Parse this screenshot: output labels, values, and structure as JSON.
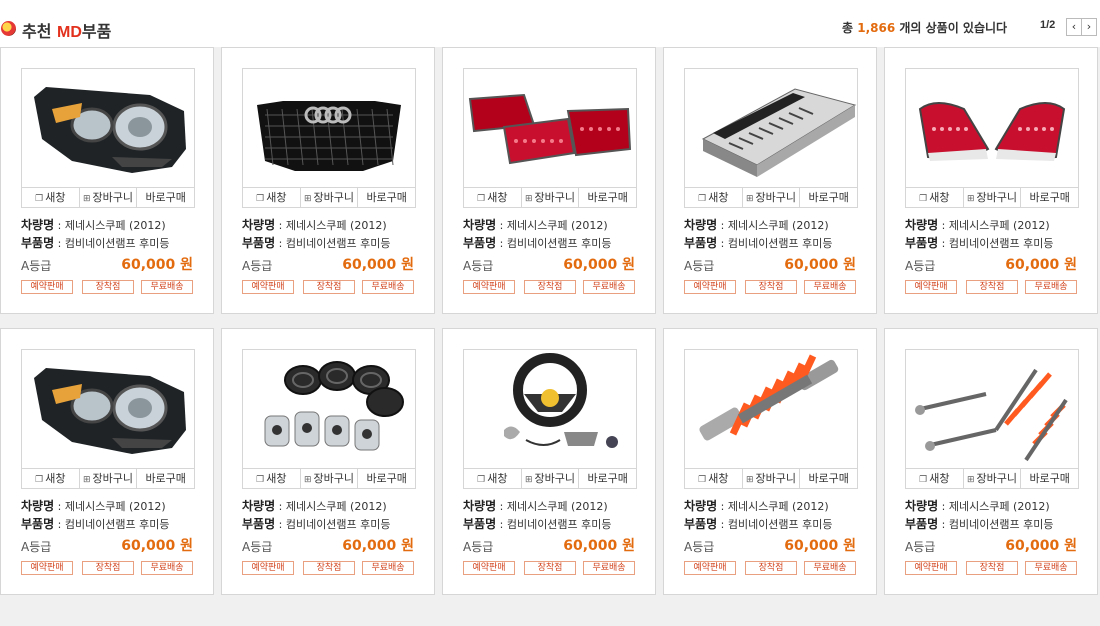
{
  "header": {
    "title_prefix": "추천 ",
    "title_accent": "MD",
    "title_suffix": "부품",
    "count_prefix": "총 ",
    "count_value": "1,866",
    "count_suffix": " 개의 상품이 있습니다",
    "pager_label": "1/2",
    "prev_label": "‹",
    "next_label": "›"
  },
  "labels": {
    "new_window": "새창",
    "cart": "장바구니",
    "buy_now": "바로구매",
    "vehicle": "차량명",
    "part": "부품명",
    "sep": " : ",
    "tag_reserve": "예약판매",
    "tag_install": "장착점",
    "tag_free": "무료배송"
  },
  "products": [
    {
      "image": "headlamp-icon",
      "vehicle": "제네시스쿠페 (2012)",
      "part": "컴비네이션램프 후미등",
      "grade": "A등급",
      "price": "60,000 원"
    },
    {
      "image": "grille-icon",
      "vehicle": "제네시스쿠페 (2012)",
      "part": "컴비네이션램프 후미등",
      "grade": "A등급",
      "price": "60,000 원"
    },
    {
      "image": "taillamp-set-icon",
      "vehicle": "제네시스쿠페 (2012)",
      "part": "컴비네이션램프 후미등",
      "grade": "A등급",
      "price": "60,000 원"
    },
    {
      "image": "amplifier-icon",
      "vehicle": "제네시스쿠페 (2012)",
      "part": "컴비네이션램프 후미등",
      "grade": "A등급",
      "price": "60,000 원"
    },
    {
      "image": "taillamp-pair-icon",
      "vehicle": "제네시스쿠페 (2012)",
      "part": "컴비네이션램프 후미등",
      "grade": "A등급",
      "price": "60,000 원"
    },
    {
      "image": "headlamp-icon",
      "vehicle": "제네시스쿠페 (2012)",
      "part": "컴비네이션램프 후미등",
      "grade": "A등급",
      "price": "60,000 원"
    },
    {
      "image": "tires-wheels-icon",
      "vehicle": "제네시스쿠페 (2012)",
      "part": "컴비네이션램프 후미등",
      "grade": "A등급",
      "price": "60,000 원"
    },
    {
      "image": "steering-wheel-icon",
      "vehicle": "제네시스쿠페 (2012)",
      "part": "컴비네이션램프 후미등",
      "grade": "A등급",
      "price": "60,000 원"
    },
    {
      "image": "coilover-icon",
      "vehicle": "제네시스쿠페 (2012)",
      "part": "컴비네이션램프 후미등",
      "grade": "A등급",
      "price": "60,000 원"
    },
    {
      "image": "coilover-set-icon",
      "vehicle": "제네시스쿠페 (2012)",
      "part": "컴비네이션램프 후미등",
      "grade": "A등급",
      "price": "60,000 원"
    }
  ]
}
